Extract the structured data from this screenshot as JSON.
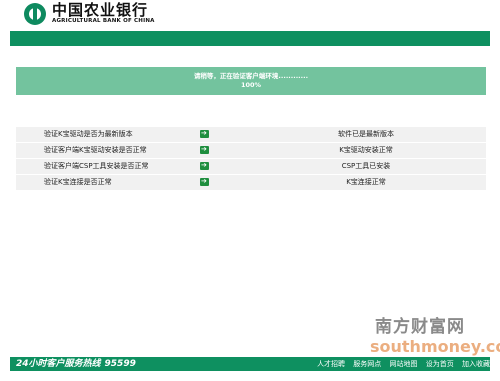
{
  "header": {
    "bank_name_cn": "中国农业银行",
    "bank_name_en": "AGRICULTURAL BANK OF CHINA"
  },
  "progress": {
    "message": "请稍等，正在验证客户端环境............",
    "percent_text": "100%",
    "percent_value": 100
  },
  "checks": [
    {
      "label": "验证K宝驱动是否为最新版本",
      "result": "软件已是最新版本",
      "icon": "arrow-right-icon"
    },
    {
      "label": "验证客户端K宝驱动安装是否正常",
      "result": "K宝驱动安装正常",
      "icon": "arrow-right-icon"
    },
    {
      "label": "验证客户端CSP工具安装是否正常",
      "result": "CSP工具已安装",
      "icon": "arrow-right-icon"
    },
    {
      "label": "验证K宝连接是否正常",
      "result": "K宝连接正常",
      "icon": "arrow-right-icon"
    }
  ],
  "footer": {
    "hotline_label": "24小时客户服务热线",
    "hotline_number": "95599",
    "links": [
      "人才招聘",
      "服务网点",
      "网站地图",
      "设为首页",
      "加入收藏"
    ]
  },
  "watermark": {
    "cn": "南方财富网",
    "en": "southmoney.com"
  },
  "colors": {
    "brand_green": "#0e9060",
    "progress_green": "#73c39e",
    "row_bg": "#f1f1f1"
  }
}
